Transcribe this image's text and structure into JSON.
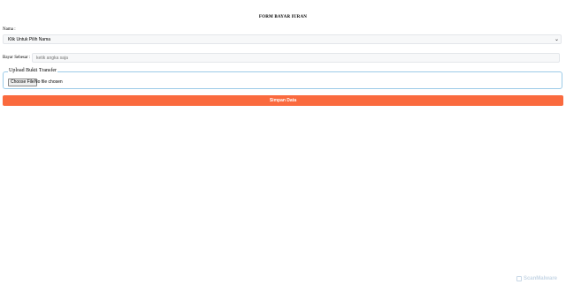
{
  "form": {
    "title": "FORM BAYAR IURAN",
    "name_label": "Nama :",
    "name_select_value": "Klik Untuk Pilih Nama",
    "amount_label": "Bayar Sebesar :",
    "amount_placeholder": "ketik angka saja",
    "upload_legend": "Upload Bukti Transfer",
    "file_button": "Choose File",
    "file_status": "No file chosen",
    "submit_label": "Simpan Data"
  },
  "watermark": {
    "text": "ScanMalware"
  },
  "icons": {
    "select_chevron": "chevron-down-icon",
    "watermark_logo": "scanmalware-logo-icon"
  },
  "colors": {
    "submit_bg": "#fa6a3e",
    "fieldset_border": "#9ccbe8",
    "field_bg": "#f7f8f9"
  }
}
